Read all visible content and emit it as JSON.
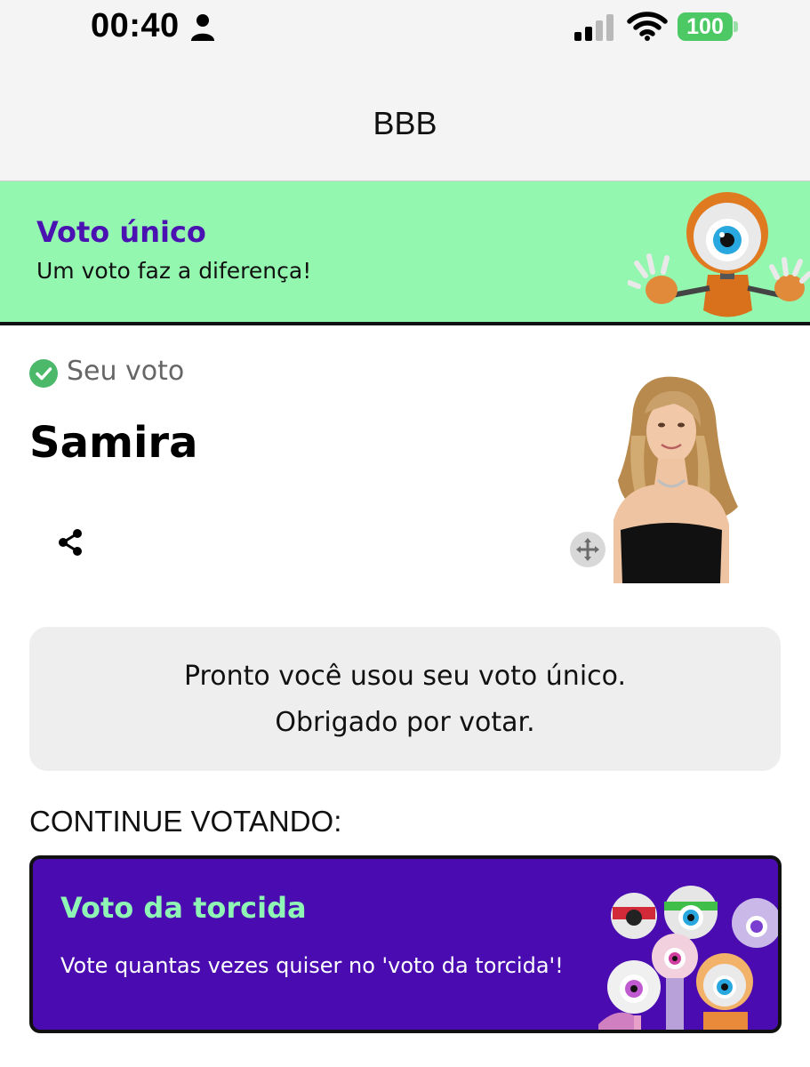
{
  "status_bar": {
    "time": "00:40",
    "battery": "100",
    "icons": [
      "person-icon",
      "signal-icon",
      "wifi-icon",
      "battery-icon"
    ]
  },
  "nav": {
    "title": "BBB"
  },
  "banner": {
    "title": "Voto único",
    "subtitle": "Um voto faz a diferença!",
    "image": "big-brother-eye-mascot"
  },
  "vote": {
    "label": "Seu voto",
    "candidate": "Samira",
    "icons": [
      "check-circle-icon",
      "share-icon",
      "expand-icon"
    ]
  },
  "message": {
    "line1": "Pronto você usou seu voto único.",
    "line2": "Obrigado por votar."
  },
  "continue_label": "CONTINUE VOTANDO:",
  "torcida": {
    "title": "Voto da torcida",
    "subtitle": "Vote quantas vezes quiser no 'voto da torcida'!",
    "image": "group-of-eye-mascots"
  },
  "colors": {
    "banner_bg": "#93f7b0",
    "accent_purple": "#4a0cb0",
    "title_purple": "#4a12b0",
    "mint_text": "#8ef5b5",
    "battery_green": "#4cc964"
  }
}
